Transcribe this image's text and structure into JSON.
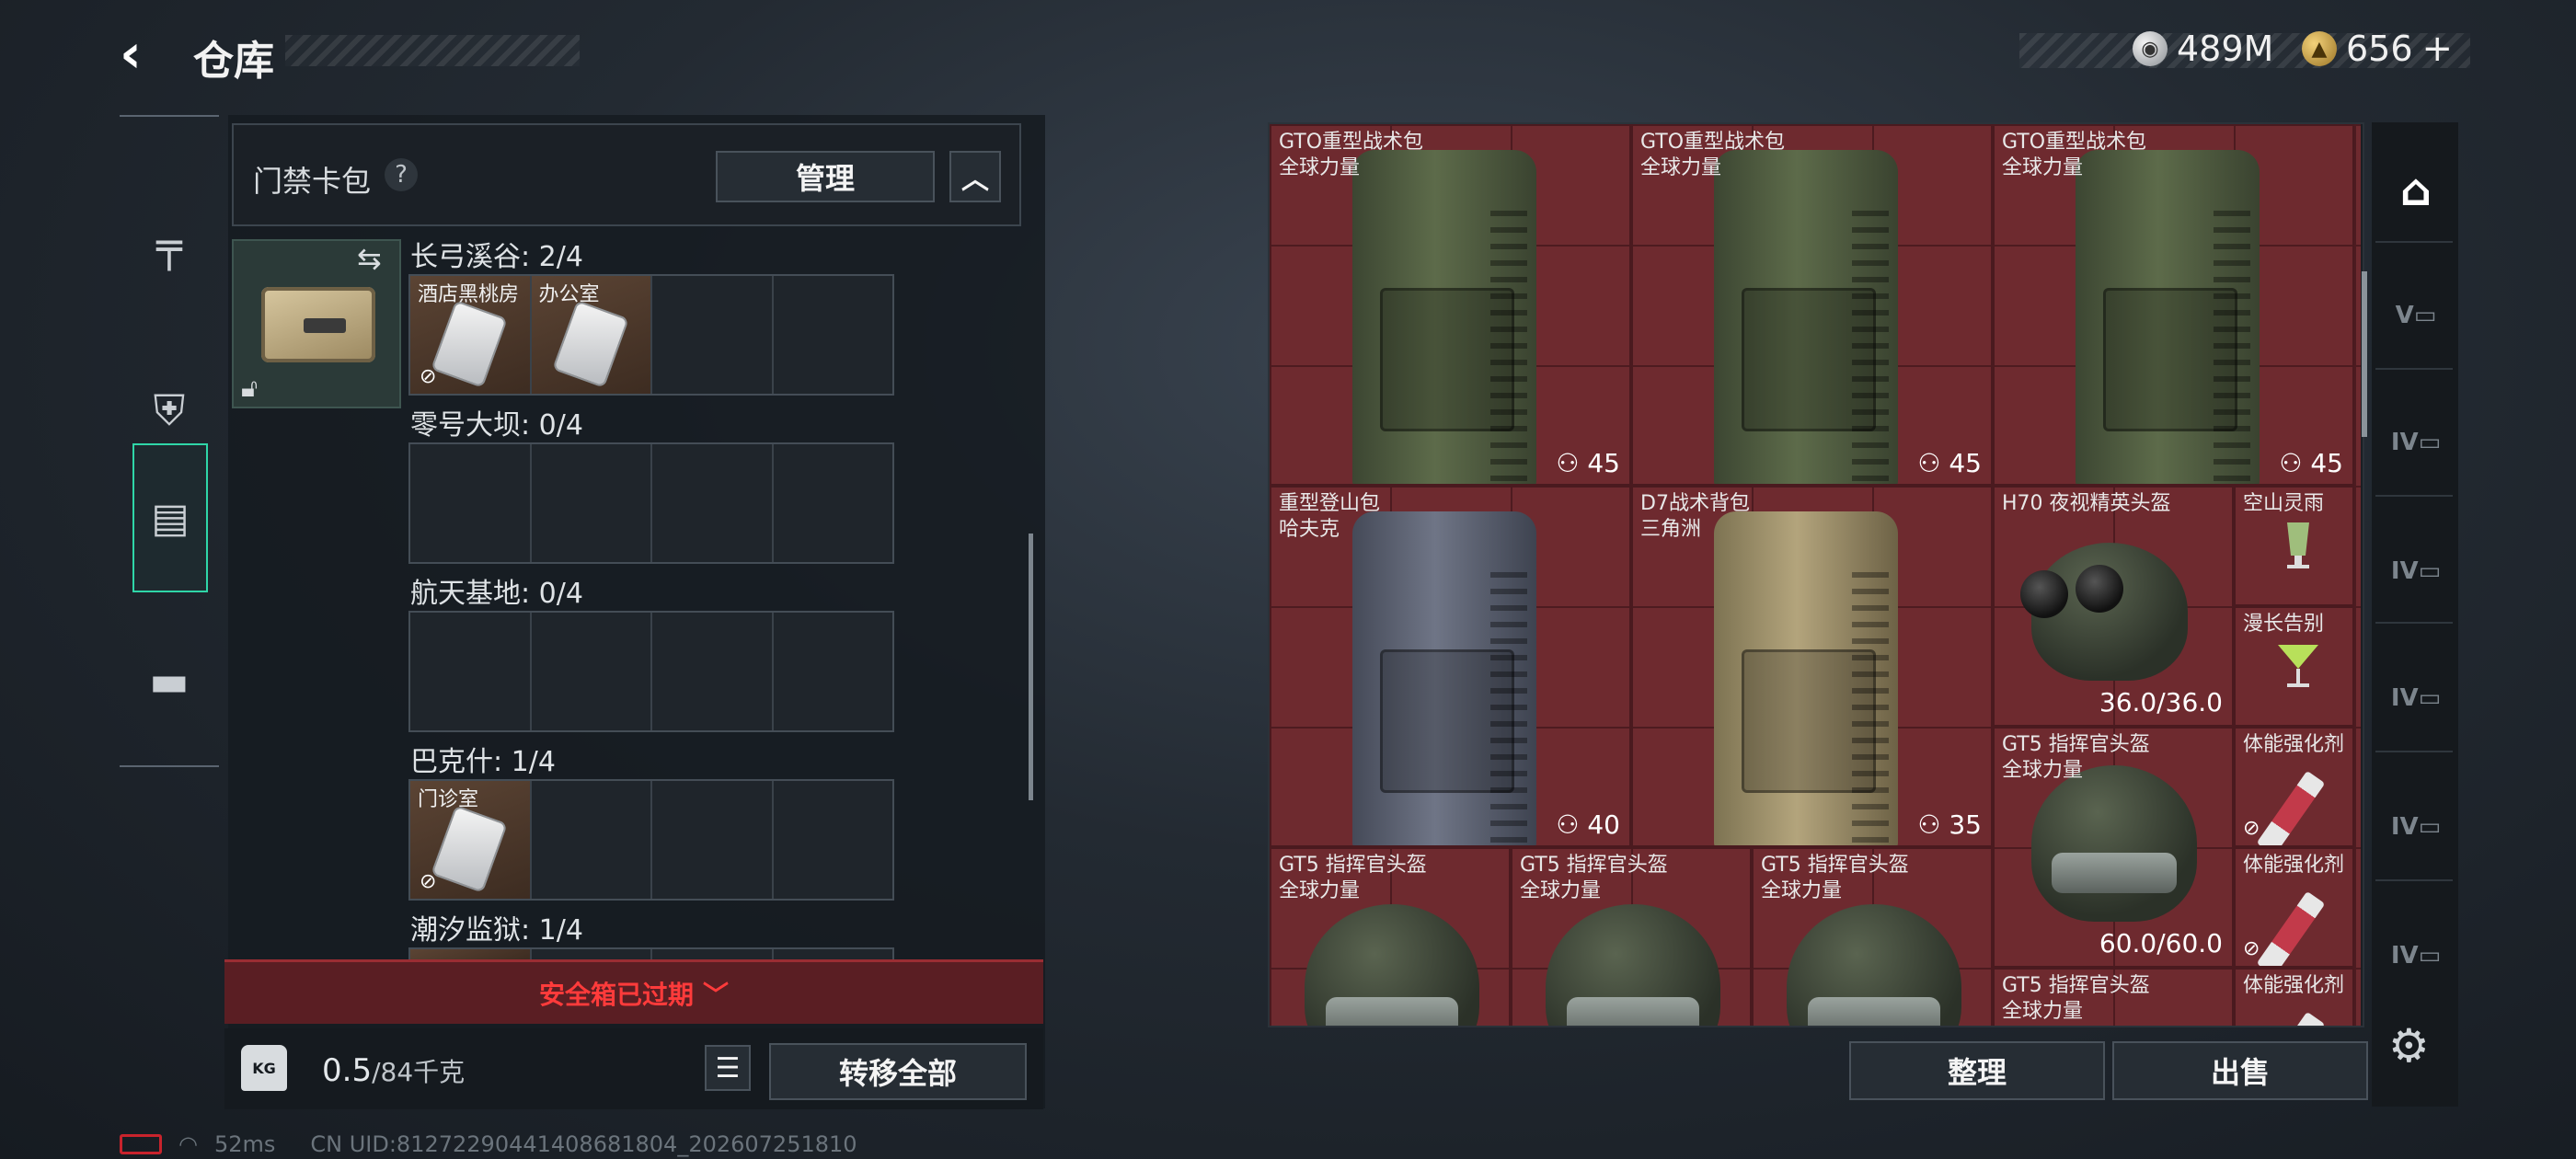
{
  "header": {
    "title": "仓库"
  },
  "currency": {
    "silver": "489M",
    "gold": "656",
    "gold_plus": "+"
  },
  "left_panel": {
    "pack_title": "门禁卡包",
    "help": "?",
    "manage_label": "管理",
    "collapse_label": "︿",
    "regions": [
      {
        "label": "长弓溪谷: 2/4",
        "slots": [
          {
            "name": "酒店黑桃房"
          },
          {
            "name": "办公室"
          }
        ]
      },
      {
        "label": "零号大坝: 0/4",
        "slots": []
      },
      {
        "label": "航天基地: 0/4",
        "slots": []
      },
      {
        "label": "巴克什: 1/4",
        "slots": [
          {
            "name": "门诊室"
          }
        ]
      },
      {
        "label": "潮汐监狱: 1/4",
        "slots": []
      }
    ],
    "expired_label": "安全箱已过期",
    "weight_value": "0.5",
    "weight_max": "/84千克",
    "kg_label": "KG",
    "transfer_label": "转移全部"
  },
  "inventory": {
    "items": [
      {
        "name": "GTO重型战术包\n全球力量",
        "count": "45"
      },
      {
        "name": "GTO重型战术包\n全球力量",
        "count": "45"
      },
      {
        "name": "GTO重型战术包\n全球力量",
        "count": "45"
      },
      {
        "name": "重型登山包\n哈夫克",
        "count": "40"
      },
      {
        "name": "D7战术背包\n三角洲",
        "count": "35"
      },
      {
        "name": "H70 夜视精英头盔",
        "durability": "36.0/36.0"
      },
      {
        "name": "空山灵雨"
      },
      {
        "name": "漫长告别"
      },
      {
        "name": "GT5 指挥官头盔\n全球力量",
        "durability": "60.0/60.0"
      },
      {
        "name": "体能强化剂"
      },
      {
        "name": "体能强化剂"
      },
      {
        "name": "体能强化剂"
      },
      {
        "name": "GT5 指挥官头盔\n全球力量"
      },
      {
        "name": "GT5 指挥官头盔\n全球力量"
      },
      {
        "name": "GT5 指挥官头盔\n全球力量"
      },
      {
        "name": "GT5 指挥官头盔\n全球力量"
      }
    ],
    "sort_label": "整理",
    "sell_label": "出售"
  },
  "filter_tabs": [
    "",
    "V",
    "IV",
    "IV",
    "IV",
    "IV",
    "IV"
  ],
  "status_bar": {
    "ping": "52ms",
    "uid": "CN UID:8127229044140868180​4_202607251810"
  },
  "colors": {
    "accent": "#2fd6a8",
    "grid_bg": "#6e2a2f",
    "alert": "#ff3b3b"
  },
  "icons": {
    "nav": [
      "pistol-icon",
      "armor-icon",
      "backpack-icon",
      "toolbox-icon"
    ],
    "settings": "gear-icon"
  }
}
